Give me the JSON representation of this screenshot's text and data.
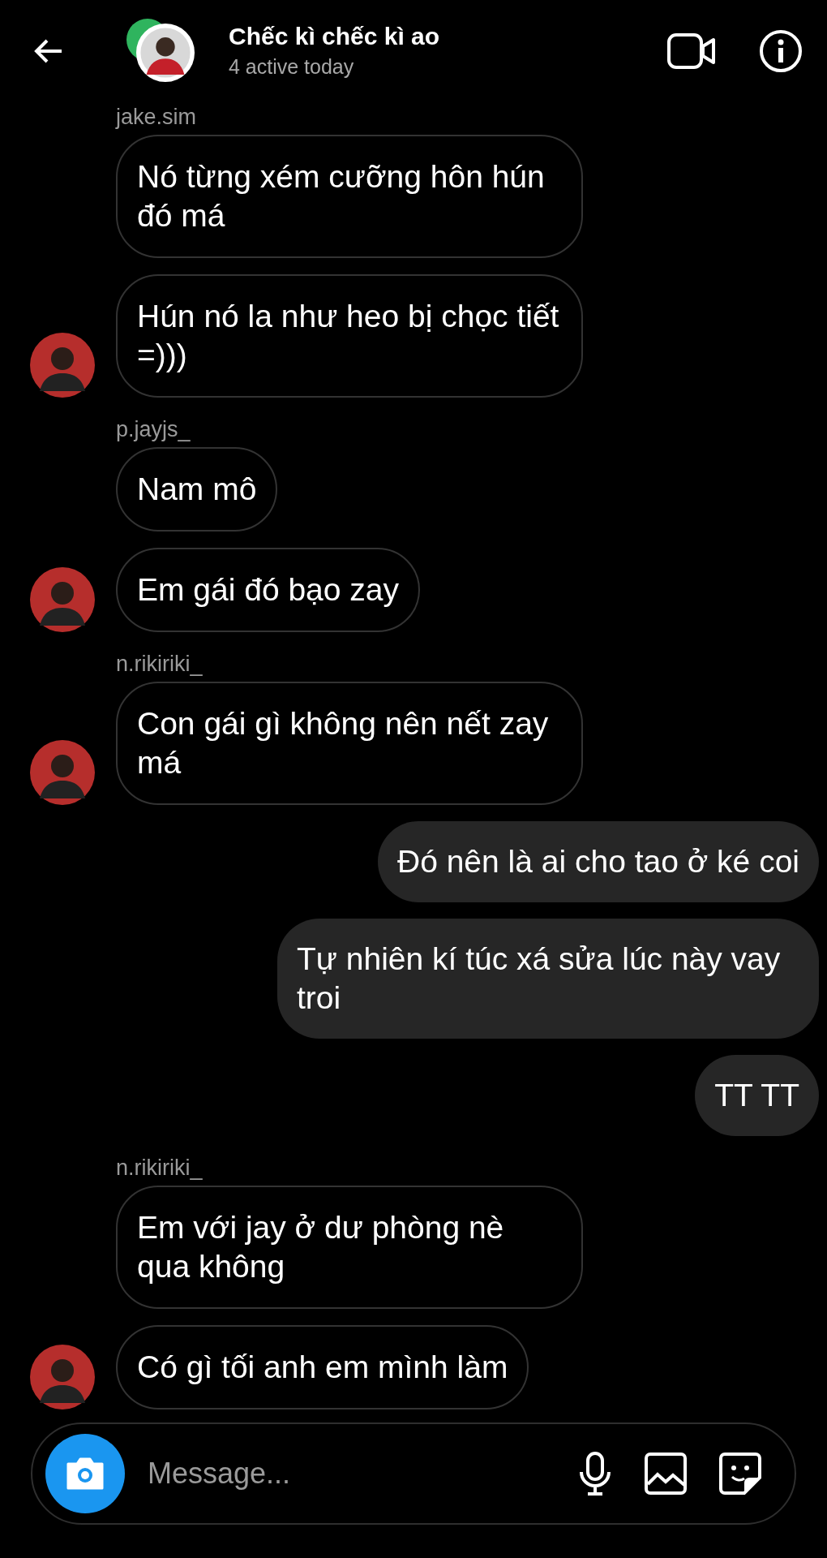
{
  "header": {
    "title": "Chếc kì chếc kì ao",
    "subtitle": "4 active today"
  },
  "messages": [
    {
      "kind": "incoming",
      "sender": "jake.sim",
      "text": "Nó từng xém cưỡng hôn hún đó má",
      "avatar": false
    },
    {
      "kind": "incoming",
      "text": "Hún nó la như heo bị chọc tiết =)))",
      "avatar": true
    },
    {
      "kind": "incoming",
      "sender": "p.jayjs_",
      "text": "Nam mô",
      "avatar": false
    },
    {
      "kind": "incoming",
      "text": "Em gái đó bạo zay",
      "avatar": true
    },
    {
      "kind": "incoming",
      "sender": "n.rikiriki_",
      "text": "Con gái gì không nên nết zay má",
      "avatar": true
    },
    {
      "kind": "outgoing",
      "text": "Đó nên là ai cho tao ở ké coi"
    },
    {
      "kind": "outgoing",
      "text": "Tự nhiên kí túc xá sửa lúc này vay troi"
    },
    {
      "kind": "outgoing",
      "text": "TT TT"
    },
    {
      "kind": "incoming",
      "sender": "n.rikiriki_",
      "text": "Em với jay ở dư phòng nè qua không",
      "avatar": false
    },
    {
      "kind": "incoming",
      "text": "Có gì tối anh em mình làm",
      "avatar": true
    }
  ],
  "composer": {
    "placeholder": "Message..."
  }
}
